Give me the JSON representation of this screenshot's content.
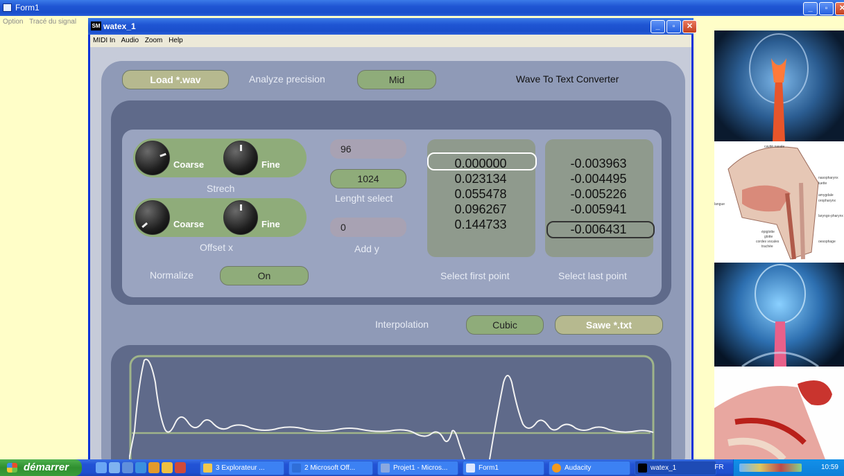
{
  "outer": {
    "title": "Form1",
    "menu": [
      "Option",
      "Tracé du signal"
    ]
  },
  "window": {
    "title": "watex_1",
    "icon_text": "SM",
    "menu": [
      "MIDI In",
      "Audio",
      "Zoom",
      "Help"
    ]
  },
  "controls": {
    "load_label": "Load   *.wav",
    "analyze_label": "Analyze precision",
    "analyze_value": "Mid",
    "app_title": "Wave To Text Converter",
    "stretch_label": "Strech",
    "offset_label": "Offset x",
    "coarse": "Coarse",
    "fine": "Fine",
    "field_96": "96",
    "length_value": "1024",
    "length_label": "Lenght select",
    "add_y_value": "0",
    "add_y_label": "Add y",
    "normalize_label": "Normalize",
    "normalize_value": "On",
    "first_point_label": "Select first point",
    "last_point_label": "Select last point",
    "interpolation_label": "Interpolation",
    "interpolation_value": "Cubic",
    "save_label": "Sawe   *.txt"
  },
  "first_points": [
    "0.000000",
    "0.023134",
    "0.055478",
    "0.096267",
    "0.144733"
  ],
  "last_points": [
    "-0.003963",
    "-0.004495",
    "-0.005226",
    "-0.005941",
    "-0.006431"
  ],
  "images": {
    "diagram_labels": [
      "cavité nasale",
      "nasopharynx",
      "luette",
      "amygdale",
      "oropharynx",
      "langue",
      "laryngo-pharynx",
      "épiglotte",
      "glotte",
      "cordes vocales",
      "trachée",
      "oesophage"
    ]
  },
  "taskbar": {
    "start": "démarrer",
    "tasks": [
      "3 Explorateur ...",
      "2 Microsoft Off...",
      "Projet1 - Micros...",
      "Form1",
      "Audacity",
      "watex_1"
    ],
    "lang": "FR",
    "clock": "10:59"
  }
}
